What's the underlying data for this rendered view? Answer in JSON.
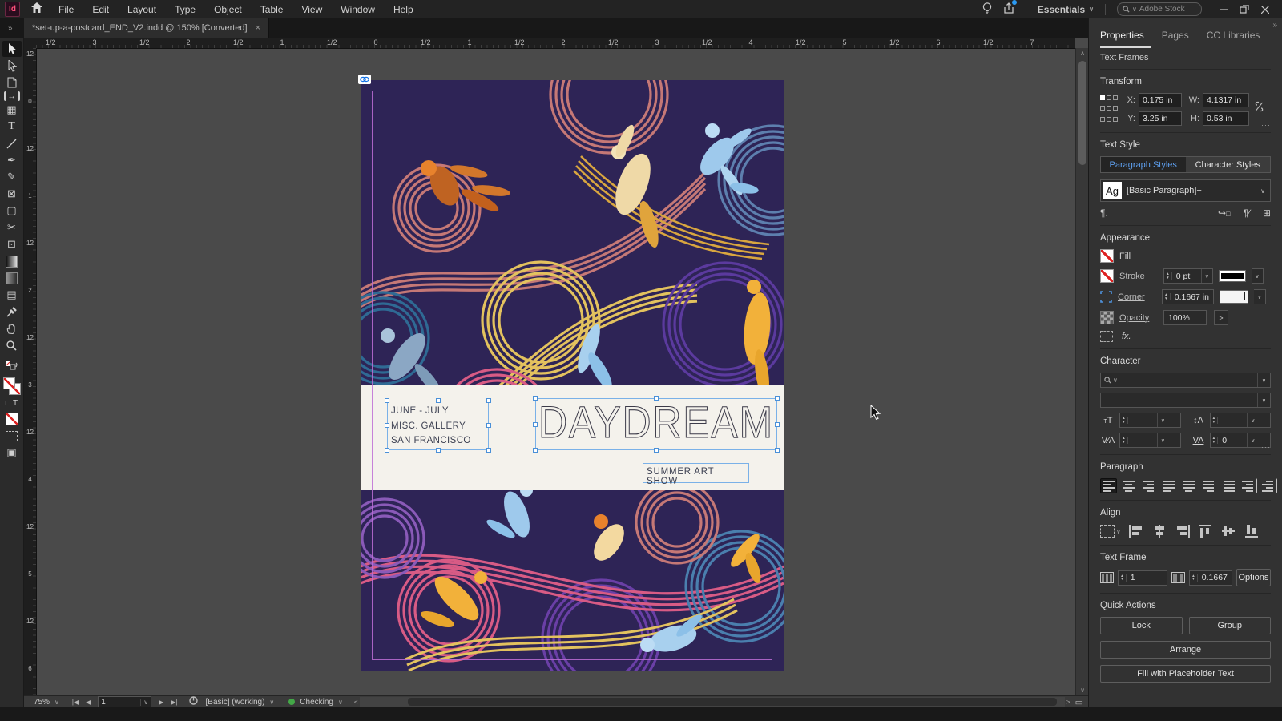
{
  "titlebar": {
    "logo_text": "Id",
    "menus": [
      "File",
      "Edit",
      "Layout",
      "Type",
      "Object",
      "Table",
      "View",
      "Window",
      "Help"
    ],
    "workspace_label": "Essentials",
    "search_placeholder": "Adobe Stock"
  },
  "document_tab": {
    "title": "*set-up-a-postcard_END_V2.indd @ 150% [Converted]",
    "close_label": "×"
  },
  "rulers": {
    "horizontal": [
      "1/2",
      "3",
      "1/2",
      "2",
      "1/2",
      "1",
      "1/2",
      "0",
      "1/2",
      "1",
      "1/2",
      "2",
      "1/2",
      "3",
      "1/2",
      "4",
      "1/2",
      "5",
      "1/2",
      "6",
      "1/2",
      "7"
    ],
    "vertical": [
      "1/2",
      "0",
      "1/2",
      "1",
      "1/2",
      "2",
      "1/2",
      "3",
      "1/2",
      "4",
      "1/2",
      "5",
      "1/2",
      "6"
    ]
  },
  "icons": {
    "collapse": "»",
    "chevron_down": "∨",
    "chevron_up": "∧",
    "chevron_left": "<",
    "chevron_right": ">",
    "stepper_up": "▴",
    "stepper_down": "▾",
    "more": "···",
    "type_tool": "T",
    "pen_tool": "✒",
    "pencil_tool": "✎",
    "frame_tool": "⊠",
    "rectangle_tool": "▢",
    "scissors_tool": "✂",
    "note_tool": "▤",
    "collector_tool": "▦",
    "gap_tool": "↔",
    "free_transform_tool": "⊡",
    "screen_mode": "▣",
    "paragraph_mark": "¶",
    "container_box": "□",
    "text_t": "T",
    "first_page": "|◀",
    "prev_page": "◀",
    "next_page": "▶",
    "last_page": "▶|",
    "spread_view": "▭"
  },
  "postcard": {
    "info_lines": [
      "JUNE - JULY",
      "MISC. GALLERY",
      "SAN FRANCISCO"
    ],
    "title": "DAYDREAM",
    "subtitle": "SUMMER ART SHOW",
    "colors": {
      "background": "#2e2456",
      "band": "#f4f2ec",
      "selection_blue": "#7ab1e8",
      "swirls": [
        "#c57876",
        "#e3c25e",
        "#2f6a94",
        "#5b3a9e",
        "#d85b85",
        "#5d7fae",
        "#6a3fa6",
        "#4a7fae",
        "#d9a63f",
        "#8a5ab8"
      ],
      "figures": [
        "#e8822c",
        "#efd9a7",
        "#9ec9ec",
        "#f2b13a",
        "#8ba7c4"
      ]
    }
  },
  "properties_panel": {
    "tabs": [
      "Properties",
      "Pages",
      "CC Libraries"
    ],
    "selection_type": "Text Frames",
    "transform": {
      "label": "Transform",
      "x_label": "X:",
      "x": "0.175 in",
      "y_label": "Y:",
      "y": "3.25 in",
      "w_label": "W:",
      "w": "4.1317 in",
      "h_label": "H:",
      "h": "0.53 in"
    },
    "text_style": {
      "label": "Text Style",
      "tabs": [
        "Paragraph Styles",
        "Character Styles"
      ],
      "sample": "Ag",
      "style_name": "[Basic Paragraph]+"
    },
    "appearance": {
      "label": "Appearance",
      "fill_label": "Fill",
      "stroke_label": "Stroke",
      "stroke_value": "0 pt",
      "corner_label": "Corner",
      "corner_value": "0.1667 in",
      "opacity_label": "Opacity",
      "opacity_value": "100%",
      "fx_label": "fx."
    },
    "character": {
      "label": "Character",
      "tracking_value": "0"
    },
    "paragraph": {
      "label": "Paragraph"
    },
    "align": {
      "label": "Align"
    },
    "text_frame": {
      "label": "Text Frame",
      "columns_value": "1",
      "gutter_value": "0.1667",
      "options_label": "Options"
    },
    "quick_actions": {
      "label": "Quick Actions",
      "buttons": [
        "Lock",
        "Group",
        "Arrange",
        "Fill with Placeholder Text"
      ]
    }
  },
  "statusbar": {
    "zoom": "75%",
    "page_number": "1",
    "preflight_profile": "[Basic] (working)",
    "preflight_status": "Checking"
  }
}
